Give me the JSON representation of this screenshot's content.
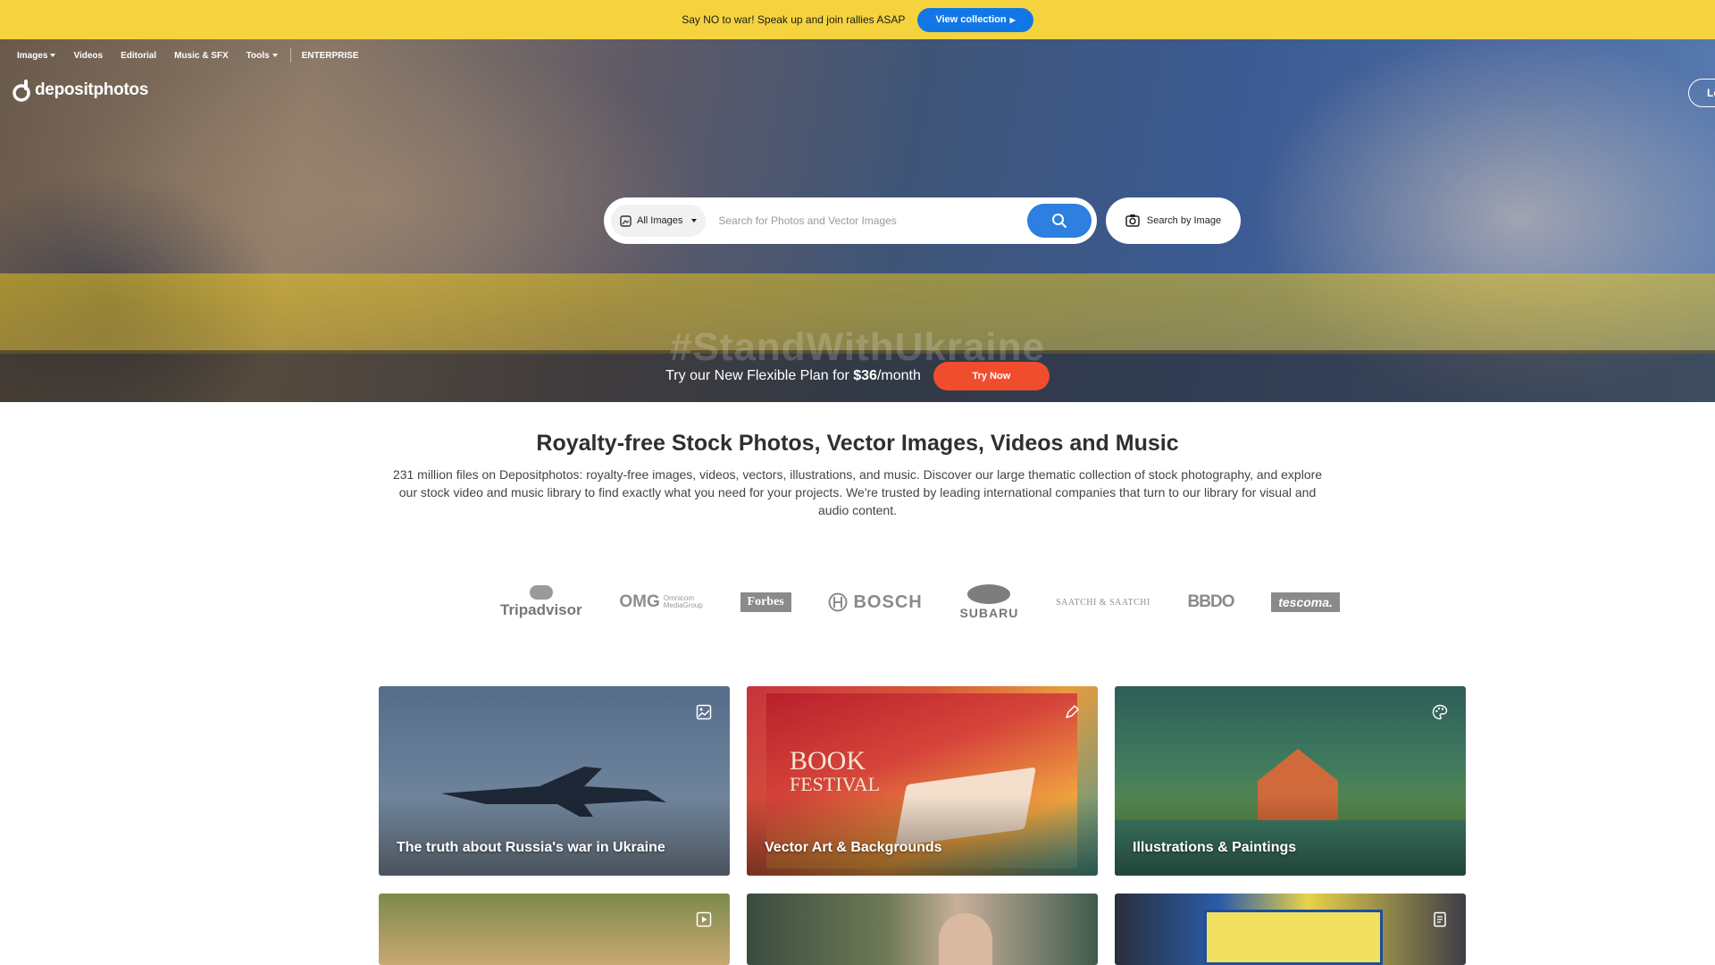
{
  "topbar": {
    "message": "Say NO to war! Speak up and join rallies ASAP",
    "button_label": "View collection",
    "button_arrow": "▶"
  },
  "nav": {
    "items": [
      {
        "label": "Images",
        "dropdown": true
      },
      {
        "label": "Videos",
        "dropdown": false
      },
      {
        "label": "Editorial",
        "dropdown": false
      },
      {
        "label": "Music & SFX",
        "dropdown": false
      },
      {
        "label": "Tools",
        "dropdown": true
      }
    ],
    "enterprise_label": "ENTERPRISE"
  },
  "logo": {
    "text": "depositphotos"
  },
  "login": {
    "label": "Lo"
  },
  "hero": {
    "tagline": "#StandWithUkraine"
  },
  "search": {
    "type_label": "All Images",
    "placeholder": "Search for Photos and Vector Images",
    "by_image_label": "Search by Image"
  },
  "promo": {
    "text_prefix": "Try our New Flexible Plan for ",
    "price": "$36",
    "text_suffix": "/month",
    "button_label": "Try Now"
  },
  "intro": {
    "heading": "Royalty-free Stock Photos, Vector Images, Videos and Music",
    "body": "231 million files on Depositphotos: royalty-free images, videos, vectors, illustrations, and music. Discover our large thematic collection of stock photography, and explore our stock video and music library to find exactly what you need for your projects. We're trusted by leading international companies that turn to our library for visual and audio content."
  },
  "brands": {
    "tripadvisor": "Tripadvisor",
    "omg": "OMG",
    "omg_sub1": "Omnicom",
    "omg_sub2": "MediaGroup",
    "forbes": "Forbes",
    "bosch": "BOSCH",
    "subaru": "SUBARU",
    "saatchi": "SAATCHI & SAATCHI",
    "bbdo": "BBDO",
    "tescoma": "tescoma."
  },
  "cards": [
    {
      "label": "The truth about Russia's war in Ukraine",
      "icon": "image-icon"
    },
    {
      "label": "Vector Art & Backgrounds",
      "icon": "pen-icon"
    },
    {
      "label": "Illustrations & Paintings",
      "icon": "palette-icon"
    },
    {
      "label": "",
      "icon": "play-icon"
    },
    {
      "label": "",
      "icon": ""
    },
    {
      "label": "",
      "icon": "editorial-icon"
    }
  ],
  "colors": {
    "topbar_bg": "#f5d33f",
    "accent_blue": "#2d7fe0",
    "promo_orange": "#f04d2f"
  }
}
